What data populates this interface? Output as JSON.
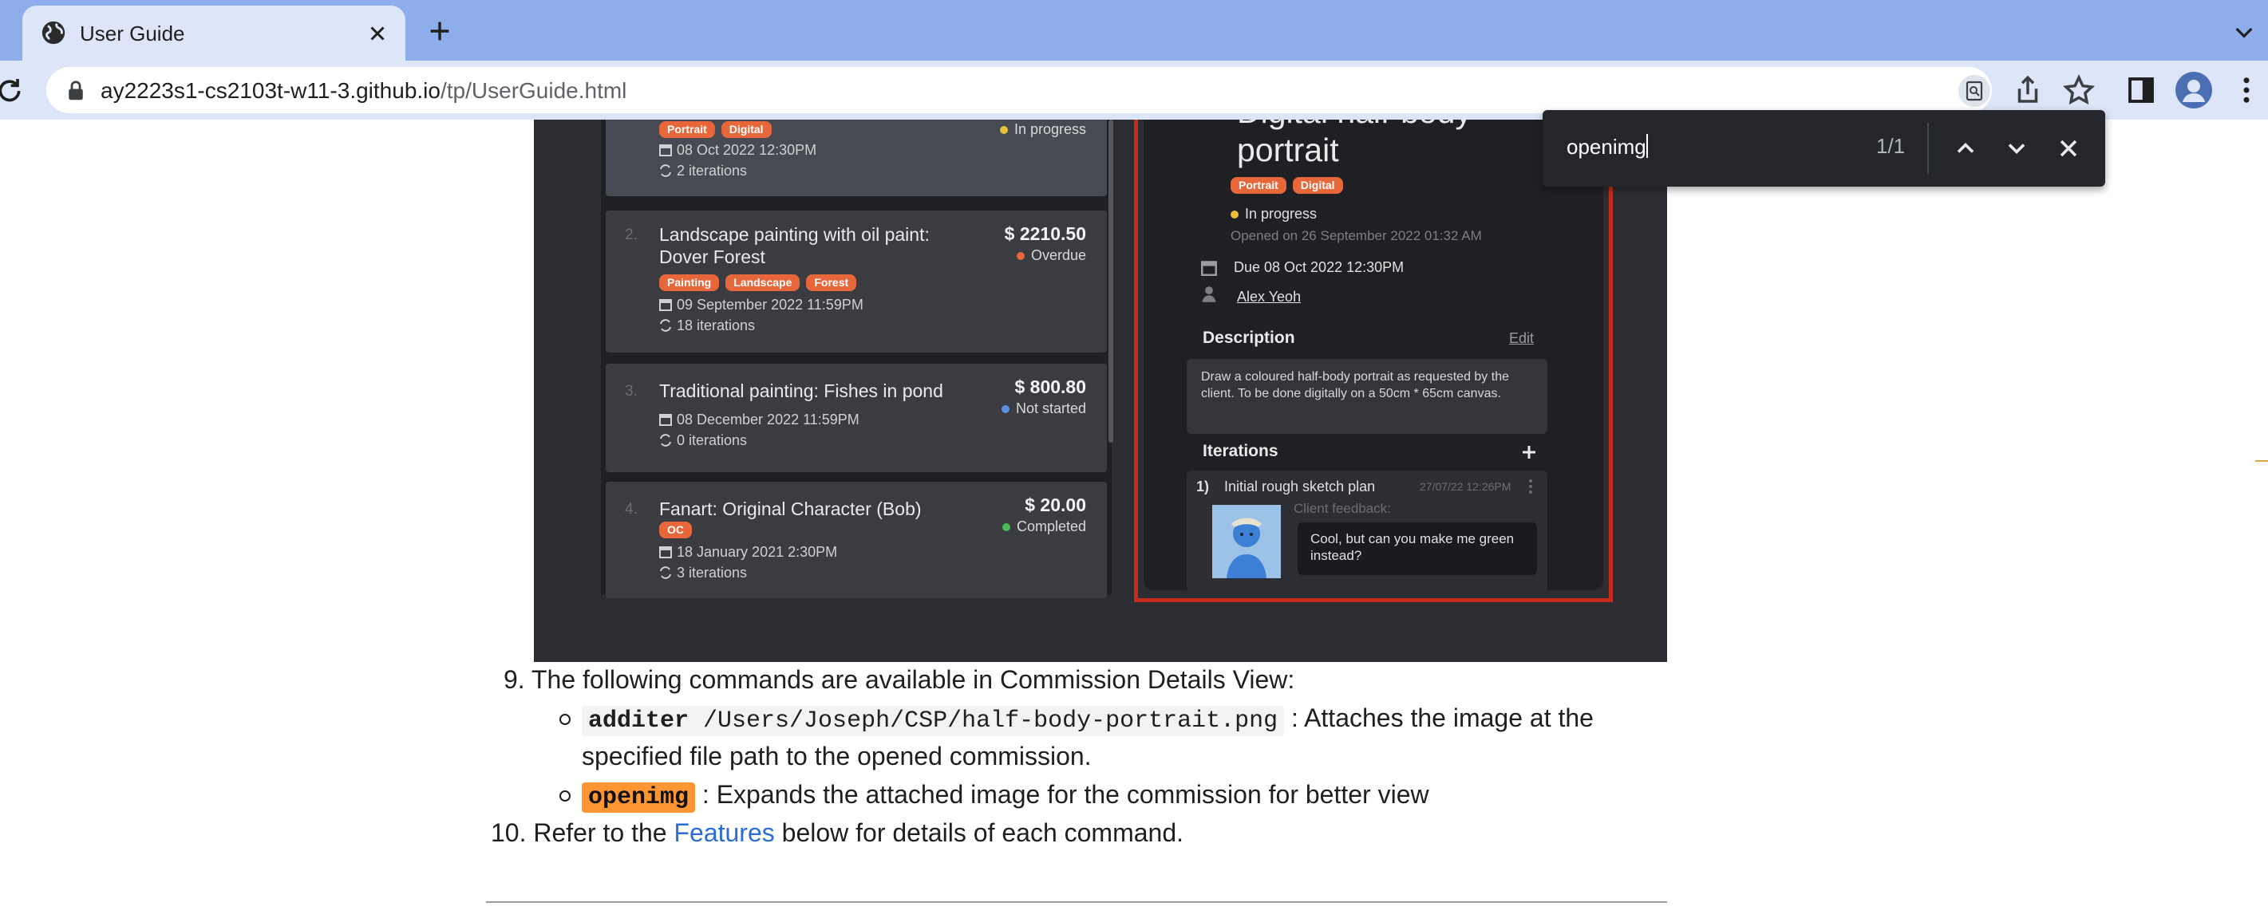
{
  "browser": {
    "tab_title": "User Guide",
    "url_host": "ay2223s1-cs2103t-w11-3.github.io",
    "url_path": "/tp/UserGuide.html"
  },
  "find_bar": {
    "query": "openimg",
    "count": "1/1"
  },
  "screenshot": {
    "commissions": [
      {
        "index": "",
        "title": "",
        "tags": [
          "Portrait",
          "Digital"
        ],
        "date": "08 Oct 2022 12:30PM",
        "iterations": "2 iterations",
        "price": "",
        "status": "In progress",
        "status_color": "#e6c03a"
      },
      {
        "index": "2.",
        "title": "Landscape painting with oil paint: Dover Forest",
        "tags": [
          "Painting",
          "Landscape",
          "Forest"
        ],
        "date": "09 September 2022 11:59PM",
        "iterations": "18 iterations",
        "price": "$ 2210.50",
        "status": "Overdue",
        "status_color": "#e8673a"
      },
      {
        "index": "3.",
        "title": "Traditional painting: Fishes in pond",
        "tags": [],
        "date": "08 December 2022 11:59PM",
        "iterations": "0 iterations",
        "price": "$ 800.80",
        "status": "Not started",
        "status_color": "#5b8fe0"
      },
      {
        "index": "4.",
        "title": "Fanart: Original Character (Bob)",
        "tags": [
          "OC"
        ],
        "date": "18 January 2021 2:30PM",
        "iterations": "3 iterations",
        "price": "$ 20.00",
        "status": "Completed",
        "status_color": "#4cb85a"
      }
    ],
    "detail": {
      "title_line1": "Digital half-body",
      "title_line2": "portrait",
      "tags": [
        "Portrait",
        "Digital"
      ],
      "status": "In progress",
      "opened": "Opened on 26 September 2022 01:32 AM",
      "due": "Due 08 Oct 2022 12:30PM",
      "customer": "Alex Yeoh",
      "description_heading": "Description",
      "edit_label": "Edit",
      "description": "Draw a coloured half-body portrait as requested by the client. To be done digitally on a 50cm * 65cm canvas.",
      "iterations_heading": "Iterations",
      "iteration": {
        "number": "1)",
        "title": "Initial rough sketch plan",
        "date": "27/07/22 12:26PM",
        "feedback_label": "Client feedback:",
        "feedback": "Cool, but can you make me green instead?"
      }
    }
  },
  "doc": {
    "item9_number": "9.",
    "item9_text": "The following commands are available in Commission Details View:",
    "cmd1_name": "additer",
    "cmd1_arg": " /Users/Joseph/CSP/half-body-portrait.png",
    "cmd1_desc_a": " : Attaches the image at the",
    "cmd1_desc_b": "specified file path to the opened commission.",
    "cmd2_name": "openimg",
    "cmd2_desc": " : Expands the attached image for the commission for better view",
    "item10_number": "10.",
    "item10_pre": "Refer to the ",
    "item10_link": "Features",
    "item10_post": " below for details of each command."
  }
}
